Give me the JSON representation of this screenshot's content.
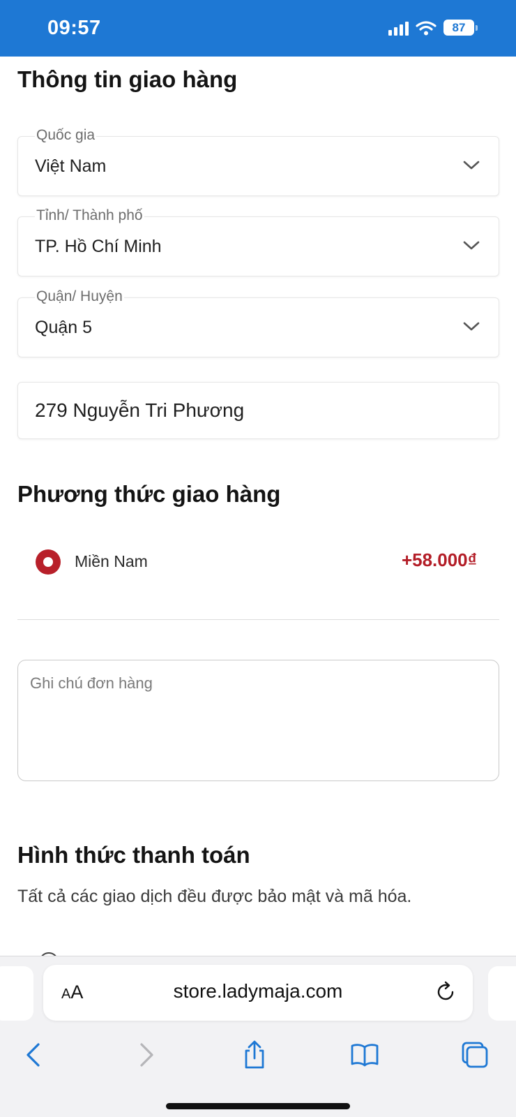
{
  "status_bar": {
    "time": "09:57",
    "battery": "87"
  },
  "shipping_info": {
    "title": "Thông tin giao hàng",
    "country": {
      "label": "Quốc gia",
      "value": "Việt Nam"
    },
    "province": {
      "label": "Tỉnh/ Thành phố",
      "value": "TP. Hồ Chí Minh"
    },
    "district": {
      "label": "Quận/ Huyện",
      "value": "Quận 5"
    },
    "address": "279 Nguyễn Tri Phương"
  },
  "shipping_method": {
    "title": "Phương thức giao hàng",
    "option_name": "Miền Nam",
    "option_price": "+58.000₫"
  },
  "order_note": {
    "placeholder": "Ghi chú đơn hàng"
  },
  "payment": {
    "title": "Hình thức thanh toán",
    "description": "Tất cả các giao dịch đều được bảo mật và mã hóa."
  },
  "browser": {
    "aa_small": "A",
    "aa_big": "A",
    "url": "store.ladymaja.com"
  },
  "colors": {
    "status_bar": "#1e78d4",
    "accent_red": "#b31d27",
    "ios_blue": "#1e78d4"
  }
}
